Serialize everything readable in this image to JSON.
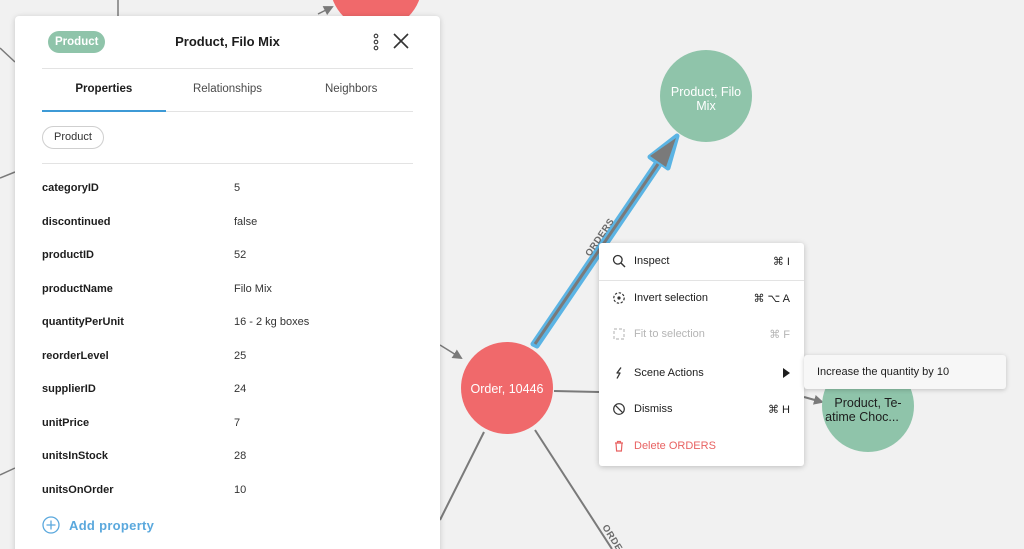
{
  "graph": {
    "nodes": [
      {
        "name": "node-product-filo-mix",
        "line1": "Product, Filo",
        "line2": "Mix",
        "color": "#8fc4aa"
      },
      {
        "name": "node-order-10446",
        "line1": "Order, 10446",
        "color": "#f0696b"
      },
      {
        "name": "node-product-teatime",
        "line1": "Product, Te-",
        "line2": "atime Choc...",
        "color": "#8fc4aa"
      }
    ],
    "selected_edge_label": "ORDERS",
    "other_edge_label": "ORDE"
  },
  "panel": {
    "label_chip": "Product",
    "title": "Product, Filo Mix",
    "more_icon": "more-vertical-icon",
    "close_icon": "close-icon",
    "tabs": [
      "Properties",
      "Relationships",
      "Neighbors"
    ],
    "active_tab": "Properties",
    "label_tag": "Product",
    "properties": [
      {
        "key": "categoryID",
        "value": "5"
      },
      {
        "key": "discontinued",
        "value": "false"
      },
      {
        "key": "productID",
        "value": "52"
      },
      {
        "key": "productName",
        "value": "Filo Mix"
      },
      {
        "key": "quantityPerUnit",
        "value": "16 - 2 kg boxes"
      },
      {
        "key": "reorderLevel",
        "value": "25"
      },
      {
        "key": "supplierID",
        "value": "24"
      },
      {
        "key": "unitPrice",
        "value": "7"
      },
      {
        "key": "unitsInStock",
        "value": "28"
      },
      {
        "key": "unitsOnOrder",
        "value": "10"
      }
    ],
    "add_property": "Add property",
    "accent_color": "#3d9ad6"
  },
  "context_menu": {
    "items": [
      {
        "label": "Inspect",
        "shortcut": "⌘ I",
        "icon": "search-icon"
      },
      {
        "label": "Invert selection",
        "shortcut": "⌘ ⌥ A",
        "icon": "invert-selection-icon"
      },
      {
        "label": "Fit to selection",
        "shortcut": "⌘ F",
        "icon": "fit-to-selection-icon",
        "disabled": true
      },
      {
        "label": "Scene Actions",
        "icon": "scene-actions-icon",
        "has_submenu": true
      },
      {
        "label": "Dismiss",
        "shortcut": "⌘ H",
        "icon": "dismiss-icon"
      },
      {
        "label": "Delete ORDERS",
        "icon": "trash-icon",
        "danger": true
      }
    ],
    "submenu_item": "Increase the quantity by 10"
  }
}
